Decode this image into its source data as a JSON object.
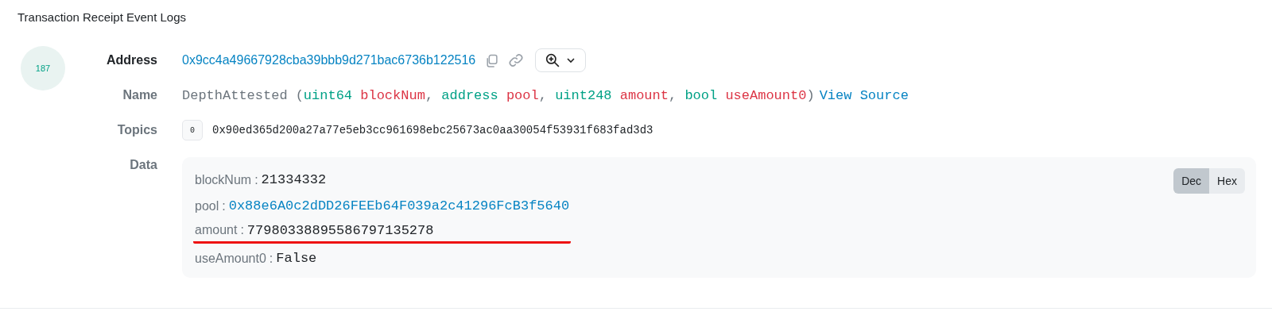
{
  "title": "Transaction Receipt Event Logs",
  "log": {
    "index": "187",
    "address": {
      "label": "Address",
      "value": "0x9cc4a49667928cba39bbb9d271bac6736b122516"
    },
    "name": {
      "label": "Name",
      "event": "DepthAttested",
      "params": [
        {
          "type": "uint64",
          "name": "blockNum"
        },
        {
          "type": "address",
          "name": "pool"
        },
        {
          "type": "uint248",
          "name": "amount"
        },
        {
          "type": "bool",
          "name": "useAmount0"
        }
      ],
      "open": "(",
      "separator": ",",
      "close": ")",
      "link": "View Source"
    },
    "topics": {
      "label": "Topics",
      "items": [
        {
          "index": "0",
          "value": "0x90ed365d200a27a77e5eb3cc961698ebc25673ac0aa30054f53931f683fad3d3"
        }
      ]
    },
    "data": {
      "label": "Data",
      "separator": ":",
      "format_toggle": [
        {
          "label": "Dec",
          "selected": true
        },
        {
          "label": "Hex",
          "selected": false
        }
      ],
      "fields": [
        {
          "name": "blockNum",
          "value": "21334332",
          "kind": "plain",
          "underlined": false
        },
        {
          "name": "pool",
          "value": "0x88e6A0c2dDD26FEEb64F039a2c41296FcB3f5640",
          "kind": "link",
          "underlined": false
        },
        {
          "name": "amount",
          "value": "77980338895586797135278",
          "kind": "plain",
          "underlined": true
        },
        {
          "name": "useAmount0",
          "value": "False",
          "kind": "plain",
          "underlined": false
        }
      ]
    }
  }
}
